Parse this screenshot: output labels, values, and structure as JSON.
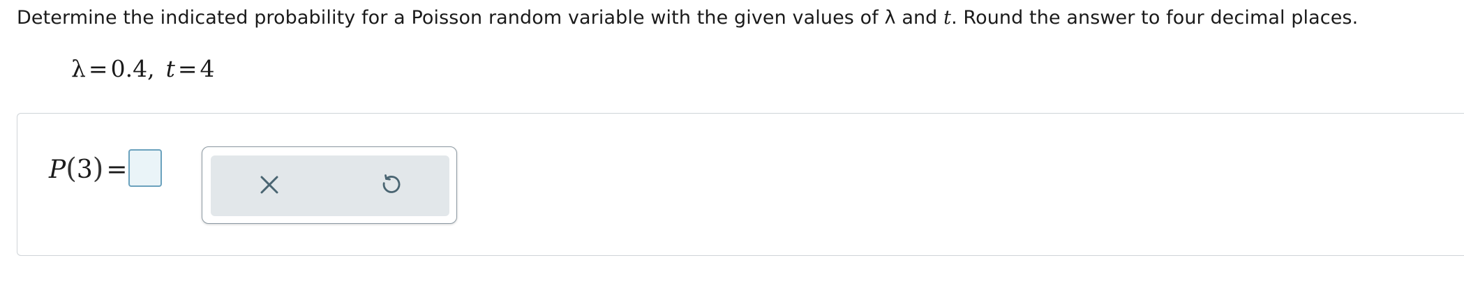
{
  "question": {
    "part1": "Determine the indicated probability for a Poisson random variable with the given values of ",
    "lambda_symbol": "λ",
    "part2": " and ",
    "t_symbol": "t",
    "part3": ". Round the answer to four decimal places."
  },
  "params": {
    "lambda_symbol": "λ",
    "equals": "=",
    "lambda_value": "0.4",
    "comma": ",",
    "t_symbol": "t",
    "t_value": "4"
  },
  "answer": {
    "function": "P",
    "open_paren": "(",
    "argument": "3",
    "close_paren": ")",
    "equals": "=",
    "input_value": ""
  },
  "tools": {
    "clear_icon": "close-icon",
    "reset_icon": "undo-icon",
    "icon_color": "#4a6572"
  },
  "colors": {
    "input_border": "#6aa1bd",
    "input_fill": "#eaf4f8",
    "toolbar_fill": "#e2e7ea"
  }
}
